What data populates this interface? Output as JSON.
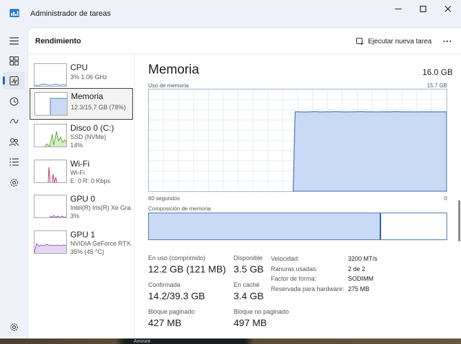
{
  "window": {
    "title": "Administrador de tareas"
  },
  "nav": {
    "items": [
      {
        "icon": "hamburger-menu-icon"
      },
      {
        "icon": "processes-icon"
      },
      {
        "icon": "performance-icon",
        "active": true
      },
      {
        "icon": "app-history-icon"
      },
      {
        "icon": "startup-apps-icon"
      },
      {
        "icon": "users-icon"
      },
      {
        "icon": "details-icon"
      },
      {
        "icon": "services-icon"
      }
    ],
    "settings_icon": "gear-icon"
  },
  "cmdbar": {
    "title": "Rendimiento",
    "run_task_label": "Ejecutar nueva tarea"
  },
  "devices": [
    {
      "name": "CPU",
      "lines": [
        "3%  1.06 GHz"
      ],
      "color": "#2f6fbf"
    },
    {
      "name": "Memoria",
      "lines": [
        "12.3/15.7 GB (78%)"
      ],
      "color": "#2f6fbf",
      "selected": true
    },
    {
      "name": "Disco 0 (C:)",
      "lines": [
        "SSD (NVMe)",
        "14%"
      ],
      "color": "#4d9a1f"
    },
    {
      "name": "Wi-Fi",
      "lines": [
        "Wi-Fi",
        "E: 0  R: 0 Kbps"
      ],
      "color": "#b4246e"
    },
    {
      "name": "GPU 0",
      "lines": [
        "Intel(R) Iris(R) Xe Gra...",
        "3%"
      ],
      "color": "#7a3ab8"
    },
    {
      "name": "GPU 1",
      "lines": [
        "NVIDIA GeForce RTX...",
        "35%  (45 °C)"
      ],
      "color": "#7a3ab8"
    }
  ],
  "detail": {
    "title": "Memoria",
    "total": "16.0 GB",
    "usage_label": "Uso de memoria",
    "usage_max": "15.7 GB",
    "time_label": "60 segundos",
    "time_min": "0",
    "composition_label": "Composición de memoria",
    "usage_history_fraction": [
      0,
      0,
      0,
      0,
      0,
      0,
      0,
      0,
      0,
      0,
      0,
      0,
      0,
      0,
      0,
      0,
      0,
      0,
      0,
      0,
      0,
      0,
      0,
      0,
      0,
      0,
      0,
      0,
      0,
      0.78,
      0.78,
      0.778,
      0.78,
      0.781,
      0.779,
      0.78,
      0.78,
      0.781,
      0.78,
      0.779,
      0.78,
      0.78,
      0.781,
      0.78,
      0.78,
      0.779,
      0.78,
      0.78,
      0.78,
      0.781,
      0.78,
      0.78,
      0.78,
      0.779,
      0.78,
      0.78,
      0.78,
      0.78,
      0.78,
      0.78
    ],
    "composition_in_use_fraction": 0.78,
    "stats": {
      "in_use_label": "En uso (comprimido)",
      "in_use_value": "12.2 GB (121 MB)",
      "available_label": "Disponible",
      "available_value": "3.5 GB",
      "committed_label": "Confirmada",
      "committed_value": "14.2/39.3 GB",
      "cached_label": "En caché",
      "cached_value": "3.4 GB",
      "paged_label": "Bloque paginado",
      "paged_value": "427 MB",
      "nonpaged_label": "Bloque no paginado",
      "nonpaged_value": "497 MB"
    },
    "props": [
      {
        "k": "Velocidad:",
        "v": "3200 MT/s"
      },
      {
        "k": "Ranuras usadas:",
        "v": "2 de 2"
      },
      {
        "k": "Factor de forma:",
        "v": "SODIMM"
      },
      {
        "k": "Reservada para hardware:",
        "v": "275 MB"
      }
    ]
  },
  "background": {
    "peek_text": "Amount"
  },
  "colors": {
    "accent": "#1f5fbf",
    "memory_fill": "#c9daf5",
    "memory_line": "#2a5ea8"
  }
}
